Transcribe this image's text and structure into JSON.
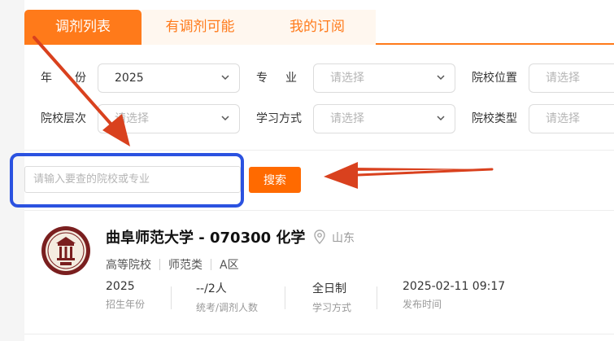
{
  "tabs": [
    {
      "label": "调剂列表",
      "active": true
    },
    {
      "label": "有调剂可能",
      "active": false
    },
    {
      "label": "我的订阅",
      "active": false
    }
  ],
  "filters": {
    "year": {
      "label_a": "年",
      "label_b": "份",
      "value": "2025"
    },
    "major": {
      "label_a": "专",
      "label_b": "业",
      "placeholder": "请选择"
    },
    "location": {
      "label": "院校位置",
      "placeholder": "请选择"
    },
    "level": {
      "label": "院校层次",
      "placeholder": "请选择"
    },
    "study_mode": {
      "label": "学习方式",
      "placeholder": "请选择"
    },
    "school_type": {
      "label": "院校类型",
      "placeholder": "请选择"
    }
  },
  "search": {
    "placeholder": "请输入要查的院校或专业",
    "button_label": "搜索"
  },
  "result": {
    "title": "曲阜师范大学 - 070300 化学",
    "location": "山东",
    "tags": [
      "高等院校",
      "师范类",
      "A区"
    ],
    "stats": [
      {
        "value": "2025",
        "label": "招生年份"
      },
      {
        "value": "--/2人",
        "label": "统考/调剂人数"
      },
      {
        "value": "全日制",
        "label": "学习方式"
      },
      {
        "value": "2025-02-11 09:17",
        "label": "发布时间"
      }
    ]
  },
  "colors": {
    "accent": "#ff7a1a",
    "button": "#ff6a00",
    "highlight": "#2b52e0",
    "arrow": "#d9411e"
  },
  "icons": {
    "dropdown": "chevron-down-icon",
    "location": "location-pin-icon",
    "logo": "university-seal-logo"
  }
}
